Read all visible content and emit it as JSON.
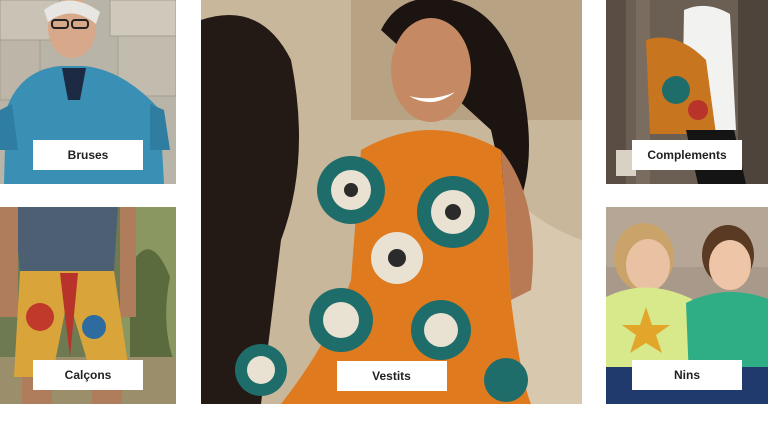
{
  "categories": [
    {
      "id": "bruses",
      "label": "Bruses"
    },
    {
      "id": "calcons",
      "label": "Calçons"
    },
    {
      "id": "vestits",
      "label": "Vestits"
    },
    {
      "id": "complements",
      "label": "Complements"
    },
    {
      "id": "nins",
      "label": "Nins"
    }
  ],
  "colors": {
    "label_bg": "#ffffff",
    "label_text": "#222222",
    "page_bg": "#ffffff"
  }
}
